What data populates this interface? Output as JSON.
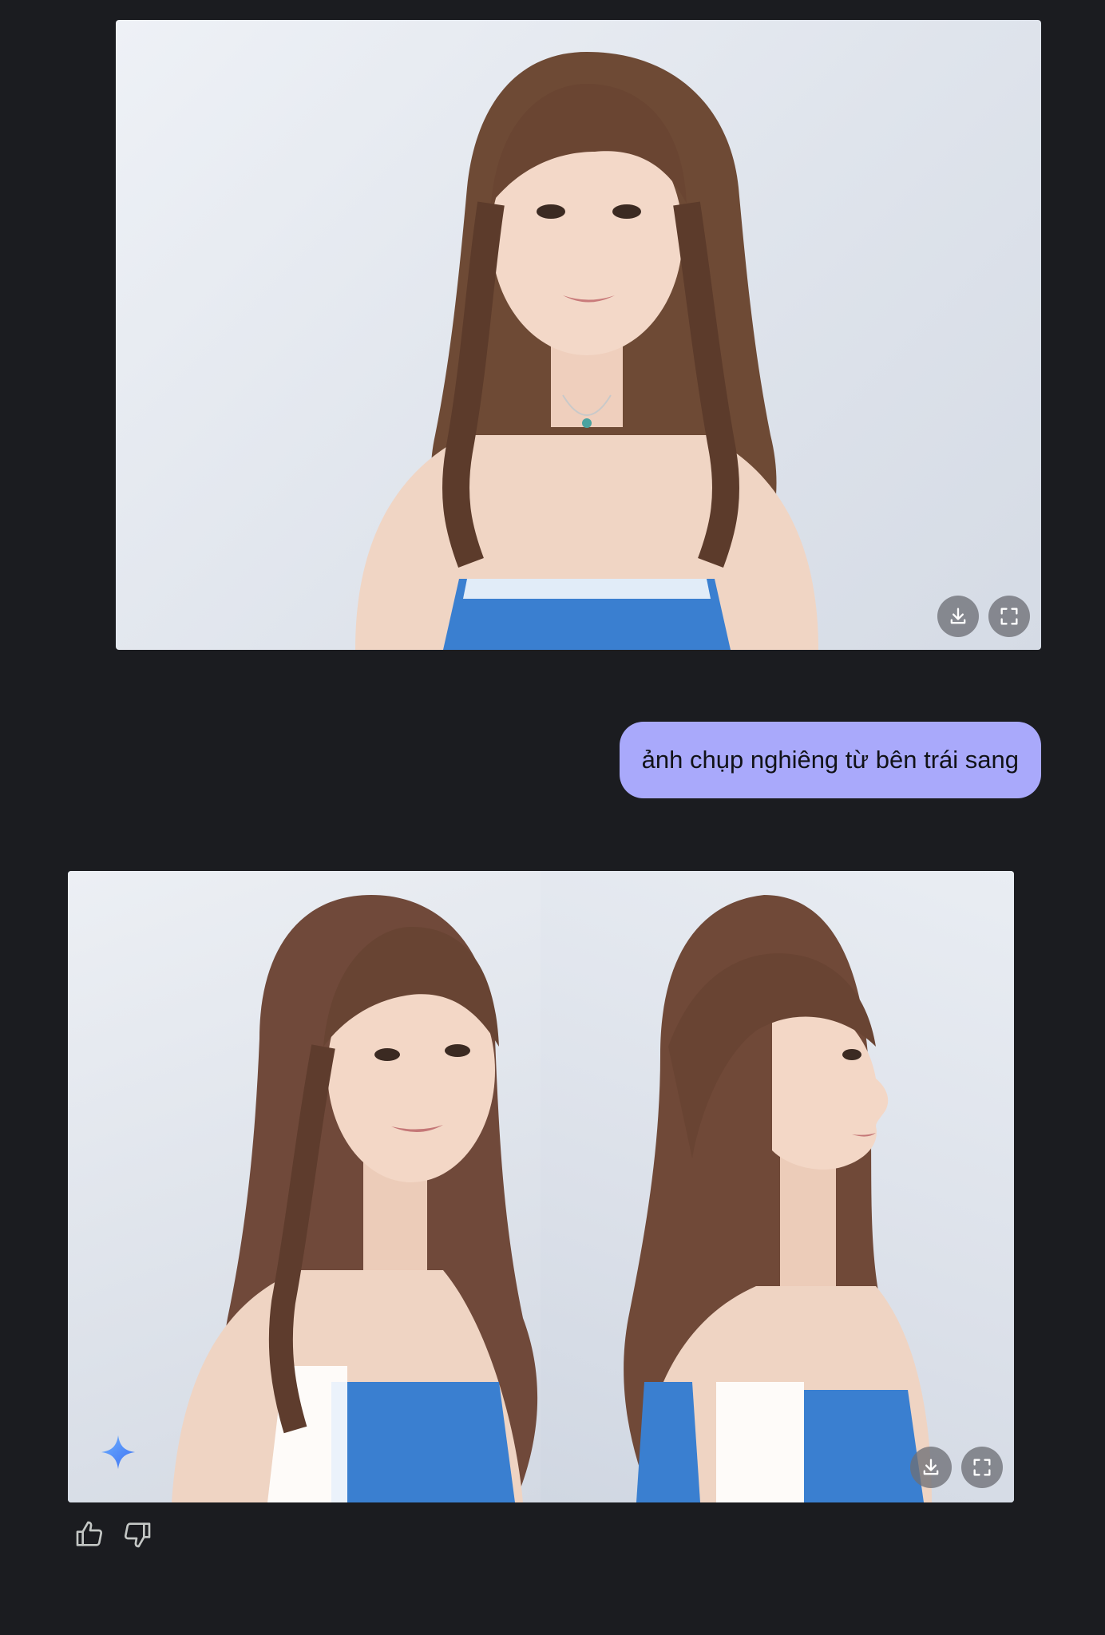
{
  "conversation": {
    "top_image": {
      "alt": "",
      "download_icon": "download-icon",
      "fullscreen_icon": "fullscreen-icon"
    },
    "user_message": {
      "text": "ảnh chụp nghiêng từ bên trái sang"
    },
    "response_image": {
      "alt": "",
      "badge_icon": "gemini-sparkle-icon",
      "download_icon": "download-icon",
      "fullscreen_icon": "fullscreen-icon"
    },
    "feedback": {
      "like_icon": "thumbs-up-icon",
      "dislike_icon": "thumbs-down-icon"
    }
  },
  "colors": {
    "background": "#1b1c20",
    "user_bubble": "#a9a9fb",
    "user_text": "#111217",
    "icon_button_bg": "#6e7076",
    "sparkle_blue": "#4f8df7"
  }
}
